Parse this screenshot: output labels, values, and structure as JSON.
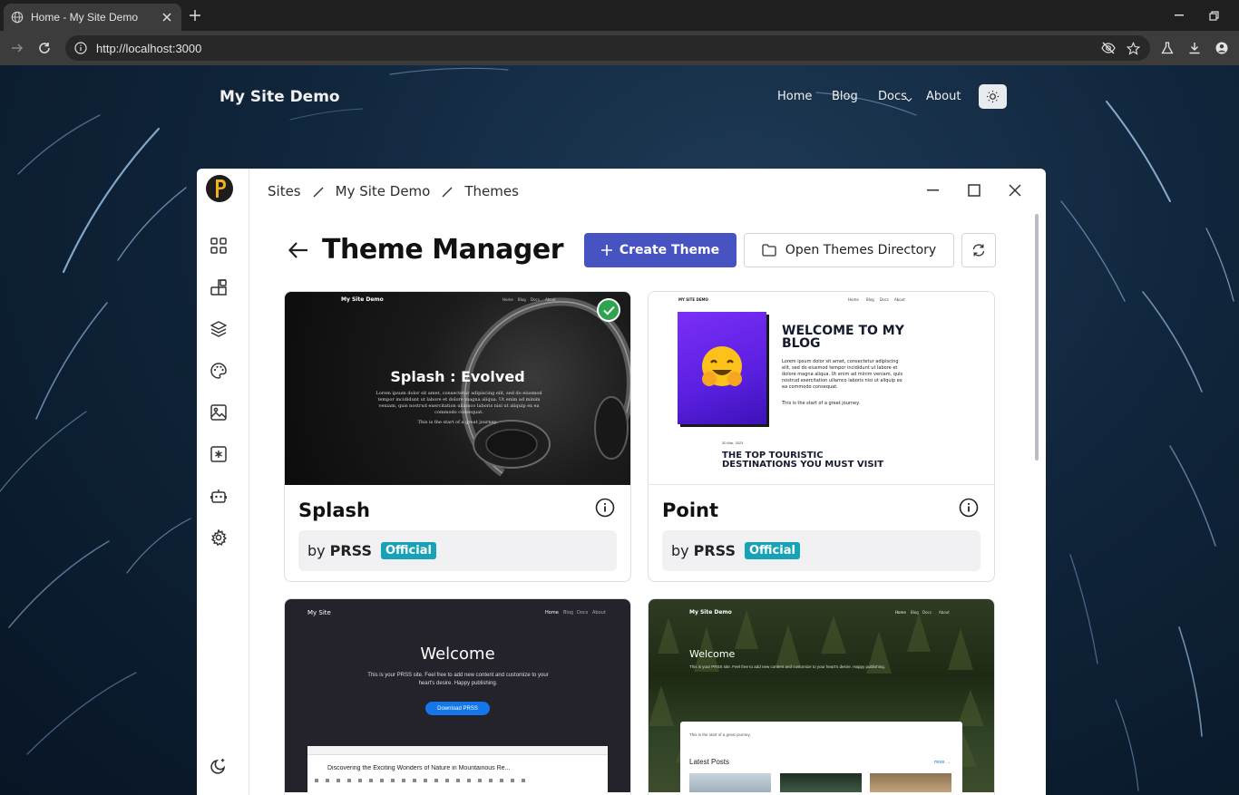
{
  "browser": {
    "tab_title": "Home - My Site Demo",
    "url": "http://localhost:3000"
  },
  "site": {
    "title": "My Site Demo",
    "nav": [
      "Home",
      "Blog",
      "Docs",
      "About"
    ]
  },
  "modal": {
    "breadcrumb": [
      "Sites",
      "My Site Demo",
      "Themes"
    ],
    "title": "Theme Manager",
    "create_button": "Create Theme",
    "open_dir_button": "Open Themes Directory"
  },
  "sidebar_icons": [
    "dashboard-icon",
    "blocks-icon",
    "layers-icon",
    "palette-icon",
    "image-icon",
    "asterisk-icon",
    "robot-icon",
    "gear-icon",
    "moon-icon"
  ],
  "themes": [
    {
      "name": "Splash",
      "author_prefix": "by",
      "author": "PRSS",
      "badge": "Official",
      "active": true,
      "preview": {
        "site": "My Site Demo",
        "nav": [
          "Home",
          "Blog",
          "Docs",
          "About"
        ],
        "heading": "Splash : Evolved",
        "body": "Lorem ipsum dolor sit amet, consectetur adipiscing elit, sed do eiusmod tempor incididunt ut labore et dolore magna aliqua. Ut enim ad minim veniam, quis nostrud exercitation ullamco laboris nisi ut aliquip ex ea commodo consequat.",
        "tagline": "This is the start of a great journey."
      }
    },
    {
      "name": "Point",
      "author_prefix": "by",
      "author": "PRSS",
      "badge": "Official",
      "active": false,
      "preview": {
        "site": "MY SITE DEMO",
        "nav": [
          "Home",
          "Blog",
          "Docs",
          "About"
        ],
        "heading": "WELCOME TO MY BLOG",
        "body": "Lorem ipsum dolor sit amet, consectetur adipiscing elit, sed do eiusmod tempor incididunt ut labore et dolore magna aliqua. Ut enim ad minim veniam, quis nostrud exercitation ullamco laboris nisi ut aliquip ex ea commodo consequat.",
        "tagline": "This is the start of a great journey.",
        "date": "30 Mar, 2023",
        "post_title": "THE TOP TOURISTIC DESTINATIONS YOU MUST VISIT"
      }
    },
    {
      "name": "",
      "preview": {
        "site": "My Site",
        "nav": [
          "Home",
          "Blog",
          "Docs",
          "About"
        ],
        "heading": "Welcome",
        "body": "This is your PRSS site. Feel free to add new content and customize to your heart's desire. Happy publishing.",
        "button": "Download PRSS",
        "embedded_title": "Discovering the Exciting Wonders of Nature in Mountainous Re..."
      }
    },
    {
      "name": "",
      "preview": {
        "site": "My Site Demo",
        "nav": [
          "Home",
          "Blog",
          "Docs",
          "About"
        ],
        "heading": "Welcome",
        "body": "This is your PRSS site. Feel free to add new content and customize to your heart's desire. Happy publishing.",
        "tagline": "This is the start of a great journey.",
        "latest": "Latest Posts",
        "more": "more →"
      }
    }
  ],
  "colors": {
    "primary": "#4753c0",
    "badge": "#17a2b8",
    "active_check": "#2ea44f"
  }
}
